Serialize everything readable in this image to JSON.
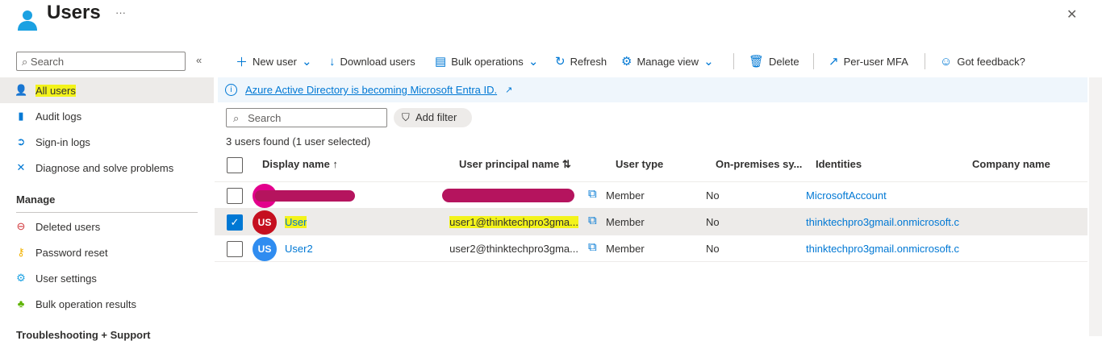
{
  "header": {
    "title": "Users",
    "more": "···",
    "close": "✕"
  },
  "sidebar": {
    "search_placeholder": "Search",
    "collapse": "«",
    "items": [
      {
        "label": "All users"
      },
      {
        "label": "Audit logs"
      },
      {
        "label": "Sign-in logs"
      },
      {
        "label": "Diagnose and solve problems"
      }
    ],
    "manage_heading": "Manage",
    "manage_items": [
      {
        "label": "Deleted users"
      },
      {
        "label": "Password reset"
      },
      {
        "label": "User settings"
      },
      {
        "label": "Bulk operation results"
      }
    ],
    "troubleshoot_heading": "Troubleshooting + Support"
  },
  "toolbar": {
    "new_user": "New user",
    "download_users": "Download users",
    "bulk_operations": "Bulk operations",
    "refresh": "Refresh",
    "manage_view": "Manage view",
    "delete": "Delete",
    "per_user_mfa": "Per-user MFA",
    "feedback": "Got feedback?"
  },
  "banner": {
    "text": "Azure Active Directory is becoming Microsoft Entra ID."
  },
  "filter": {
    "search_placeholder": "Search",
    "add_filter": "Add filter"
  },
  "count": "3 users found (1 user selected)",
  "columns": {
    "display_name": "Display name ↑",
    "upn": "User principal name ⇅",
    "user_type": "User type",
    "on_prem": "On-premises sy...",
    "identities": "Identities",
    "company": "Company name"
  },
  "rows": [
    {
      "initials": "",
      "name": "",
      "upn": "",
      "type": "Member",
      "on_prem": "No",
      "identities": "MicrosoftAccount",
      "selected": false,
      "avatar_color": "#e3008c"
    },
    {
      "initials": "US",
      "name": "User",
      "upn": "user1@thinktechpro3gma...",
      "type": "Member",
      "on_prem": "No",
      "identities": "thinktechpro3gmail.onmicrosoft.c",
      "selected": true,
      "avatar_color": "#c50f1f"
    },
    {
      "initials": "US",
      "name": "User2",
      "upn": "user2@thinktechpro3gma...",
      "type": "Member",
      "on_prem": "No",
      "identities": "thinktechpro3gmail.onmicrosoft.c",
      "selected": false,
      "avatar_color": "#2f8cf0"
    }
  ]
}
